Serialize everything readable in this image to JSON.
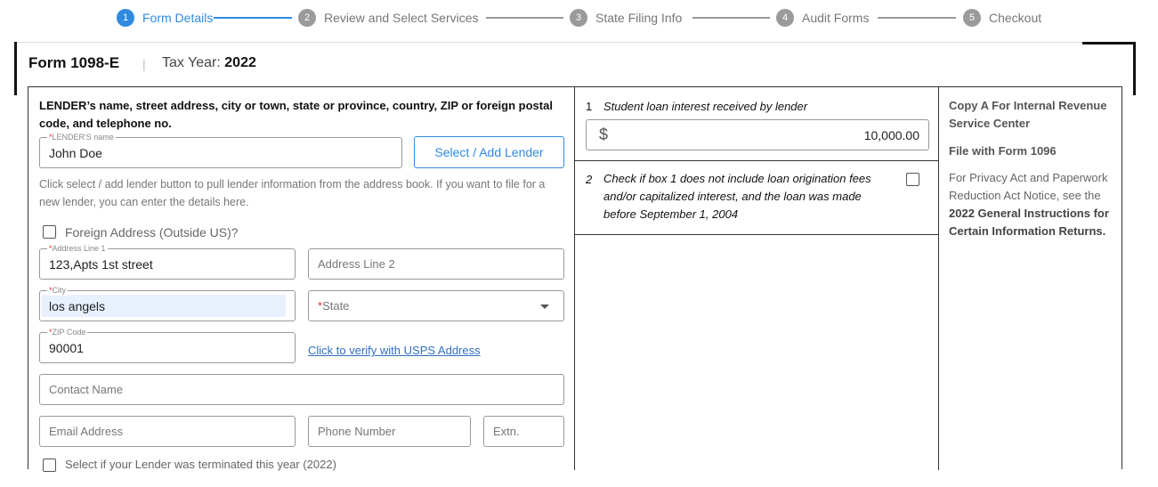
{
  "stepper": {
    "steps": [
      {
        "num": "1",
        "label": "Form Details"
      },
      {
        "num": "2",
        "label": "Review and Select Services"
      },
      {
        "num": "3",
        "label": "State Filing Info"
      },
      {
        "num": "4",
        "label": "Audit Forms"
      },
      {
        "num": "5",
        "label": "Checkout"
      }
    ]
  },
  "header": {
    "form_name": "Form 1098-E",
    "separator": "|",
    "tax_year_label": "Tax Year:",
    "tax_year_value": "2022"
  },
  "lender": {
    "heading": "LENDER’s name, street address, city or town, state or province, country, ZIP or foreign postal code, and telephone no.",
    "name_label": "LENDER'S name",
    "name_value": "John Doe",
    "select_button": "Select / Add Lender",
    "hint": "Click select / add lender button to pull lender information from the address book. If you want to file for a new lender, you can enter the details here.",
    "foreign_label": "Foreign Address (Outside US)?",
    "address1_label": "Address Line 1",
    "address1_value": "123,Apts 1st street",
    "address2_placeholder": "Address Line 2",
    "city_label": "City",
    "city_value": "los angels",
    "state_placeholder": "State",
    "zip_label": "ZIP Code",
    "zip_value": "90001",
    "verify_link": "Click to verify with USPS Address",
    "contact_placeholder": "Contact Name",
    "email_placeholder": "Email Address",
    "phone_placeholder": "Phone Number",
    "ext_placeholder": "Extn.",
    "terminated_label": "Select if your Lender was terminated this year (2022)"
  },
  "box1": {
    "num": "1",
    "label": "Student loan interest received by lender",
    "currency": "$",
    "amount": "10,000.00"
  },
  "box2": {
    "num": "2",
    "label": "Check if box 1 does not include loan origination fees and/or capitalized interest, and the loan was made before September 1, 2004"
  },
  "copy_info": {
    "copy_a": "Copy A For Internal Revenue Service Center",
    "file_with": "File with Form 1096",
    "privacy_text": "For Privacy Act and Paperwork Reduction Act Notice, see the",
    "instructions": "2022 General Instructions for Certain Information Returns."
  },
  "colors": {
    "accent": "#2f8ae0",
    "link": "#2f6fc0",
    "required": "#dd3333"
  }
}
